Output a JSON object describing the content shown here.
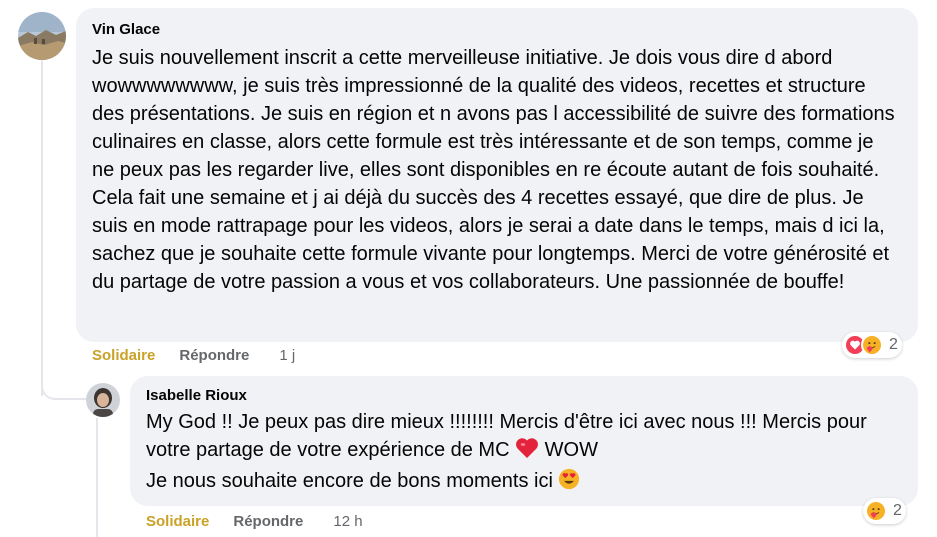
{
  "comments": [
    {
      "author": "Vin Glace",
      "text": "Je suis nouvellement inscrit a cette merveilleuse initiative. Je dois vous dire d abord wowwwwwwww, je suis très impressionné de la qualité des videos, recettes et structure des présentations. Je suis en région et n avons pas l accessibilité de suivre des formations culinaires en classe, alors cette formule est très intéressante et de son temps, comme je ne peux pas les regarder live, elles sont disponibles en re écoute autant de fois souhaité. Cela fait une semaine et j ai déjà du succès des 4 recettes essayé, que dire de plus. Je suis en mode rattrapage pour les videos, alors je serai a date dans le temps, mais d ici la, sachez que je souhaite cette formule vivante pour longtemps. Merci de votre générosité et du partage de votre passion a vous et vos collaborateurs. Une passionnée de bouffe!",
      "like_label": "Solidaire",
      "reply_label": "Répondre",
      "time": "1 j",
      "reaction_count": "2",
      "reaction_icons": [
        "heart-icon",
        "care-icon"
      ]
    },
    {
      "author": "Isabelle Rioux",
      "text_part1": "My God !! Je peux pas dire mieux !!!!!!!! Mercis d'être ici avec nous !!! Mercis pour votre partage de votre expérience de MC",
      "text_part2": "WOW",
      "text_part3": "Je nous souhaite encore de bons moments ici",
      "inline_emojis": [
        "heart-emoji",
        "heart-eyes-emoji"
      ],
      "like_label": "Solidaire",
      "reply_label": "Répondre",
      "time": "12 h",
      "reaction_count": "2",
      "reaction_icons": [
        "care-icon"
      ]
    }
  ],
  "colors": {
    "bubble": "#f0f2f5",
    "like_active": "#c9a227",
    "secondary_text": "#65676b",
    "heart_red": "#f33e58",
    "care_yellow": "#f7b125"
  }
}
